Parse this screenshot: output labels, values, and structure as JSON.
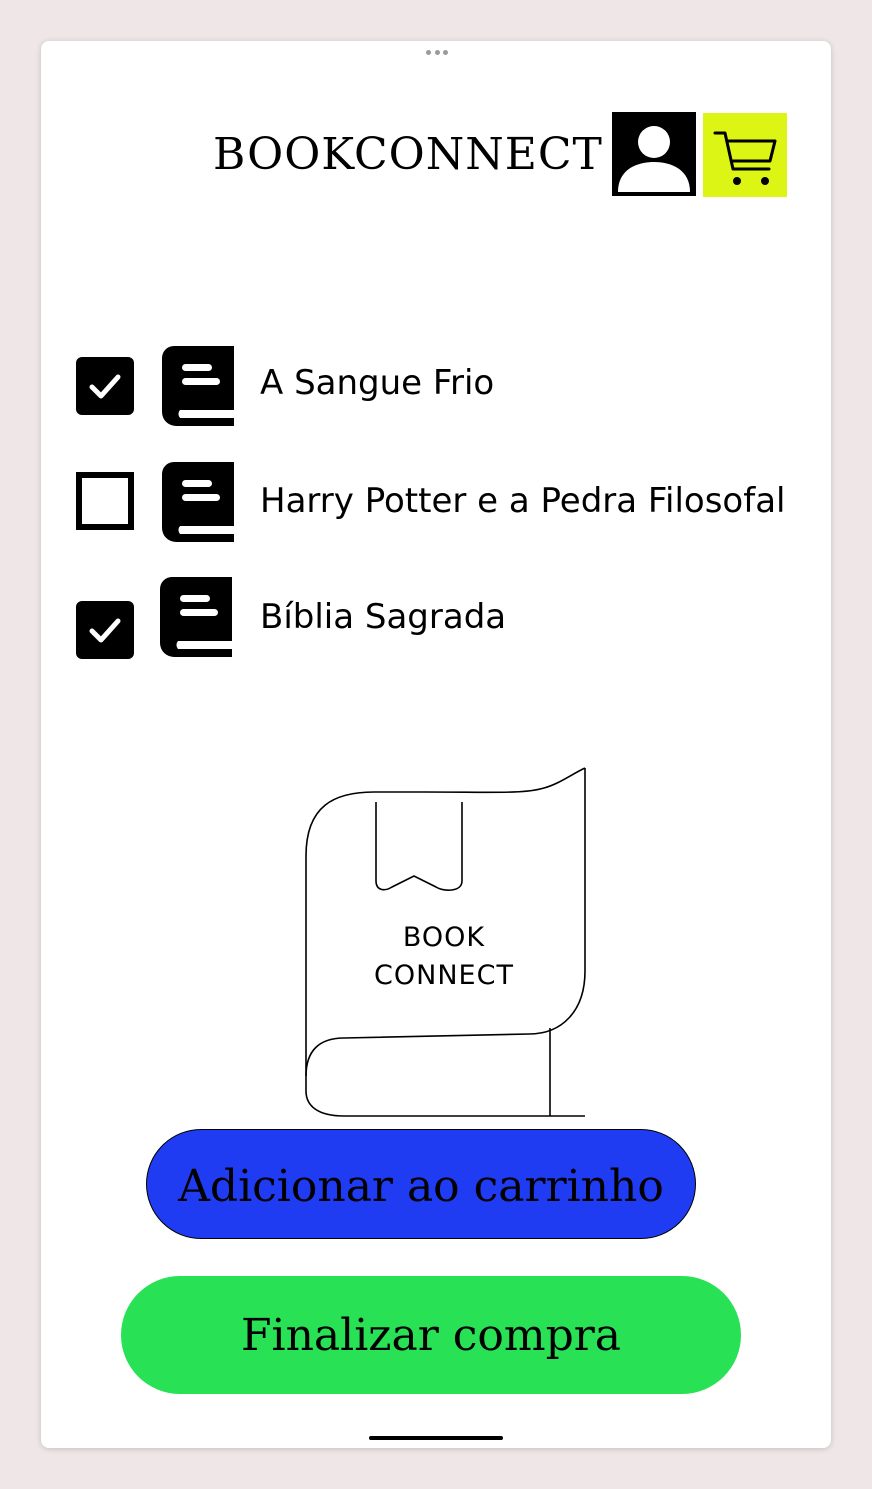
{
  "header": {
    "brand": "BOOKCONNECT"
  },
  "books": [
    {
      "title": "A Sangue Frio",
      "checked": true
    },
    {
      "title": "Harry Potter e a Pedra Filosofal",
      "checked": false
    },
    {
      "title": "Bíblia Sagrada",
      "checked": true
    }
  ],
  "logo": {
    "line1": "BOOK",
    "line2": "CONNECT"
  },
  "actions": {
    "add_to_cart": "Adicionar ao carrinho",
    "checkout": "Finalizar compra"
  },
  "colors": {
    "cart_bg": "#dcf515",
    "add_button": "#1f3cf2",
    "checkout_button": "#28e155"
  },
  "icons": {
    "profile": "user-icon",
    "cart": "cart-icon",
    "book": "book-icon",
    "check": "check-icon"
  }
}
